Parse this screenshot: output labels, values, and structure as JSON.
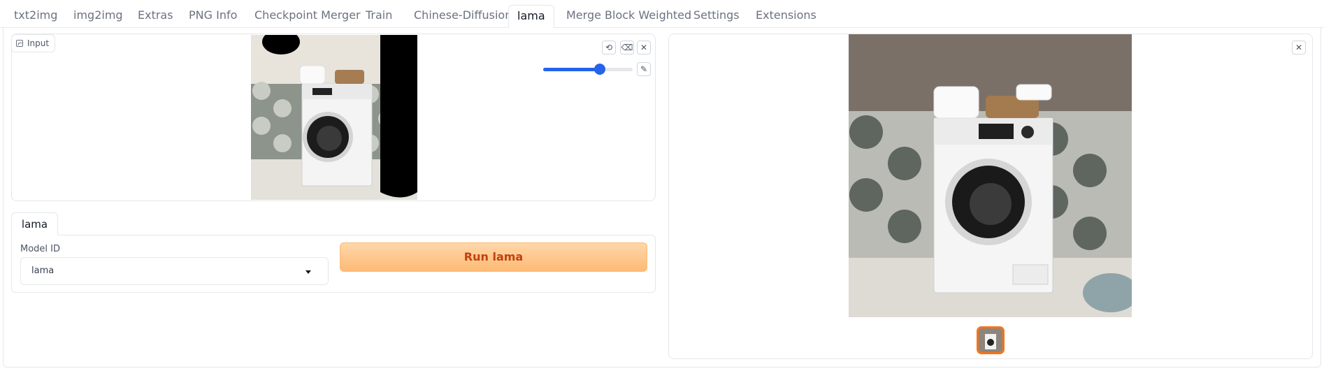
{
  "tabs": [
    {
      "label": "txt2img"
    },
    {
      "label": "img2img"
    },
    {
      "label": "Extras"
    },
    {
      "label": "PNG Info"
    },
    {
      "label": "Checkpoint Merger"
    },
    {
      "label": "Train"
    },
    {
      "label": "Chinese-Diffusion"
    },
    {
      "label": "lama"
    },
    {
      "label": "Merge Block Weighted"
    },
    {
      "label": "Settings"
    },
    {
      "label": "Extensions"
    }
  ],
  "active_tab": "lama",
  "input_panel": {
    "label": "Input",
    "brush_size_percent": 65
  },
  "lama_section": {
    "tab_label": "lama",
    "model_label": "Model ID",
    "model_value": "lama",
    "run_label": "Run lama"
  },
  "colors": {
    "accent": "#f97316",
    "slider": "#2563eb",
    "run_button_text": "#c2410c"
  },
  "icons": {
    "undo": "undo-icon",
    "eraser": "eraser-icon",
    "close": "close-icon",
    "brush": "brush-icon",
    "image": "image-icon"
  }
}
